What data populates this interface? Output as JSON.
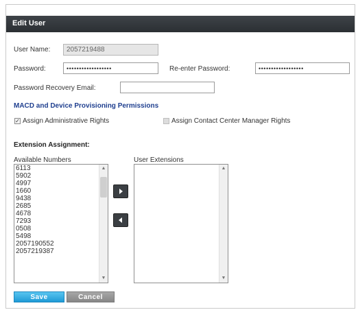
{
  "dialog": {
    "title": "Edit User"
  },
  "form": {
    "user_name_label": "User Name:",
    "user_name_value": "2057219488",
    "password_label": "Password:",
    "password_value": "••••••••••••••••••",
    "reenter_password_label": "Re-enter Password:",
    "reenter_password_value": "••••••••••••••••••",
    "recovery_email_label": "Password Recovery Email:",
    "recovery_email_value": ""
  },
  "permissions": {
    "section_title": "MACD and Device Provisioning Permissions",
    "admin_rights_label": "Assign Administrative Rights",
    "admin_rights_checked": true,
    "contact_center_label": "Assign Contact Center Manager Rights",
    "contact_center_checked": false
  },
  "extensions": {
    "heading": "Extension Assignment:",
    "available_label": "Available Numbers",
    "user_extensions_label": "User Extensions",
    "available_numbers": [
      "6113",
      "5902",
      "4997",
      "1660",
      "9438",
      "2685",
      "4678",
      "7293",
      "0508",
      "5498",
      "2057190552",
      "2057219387"
    ],
    "user_extensions": []
  },
  "icons": {
    "move_right": "arrow-right-icon",
    "move_left": "arrow-left-icon"
  },
  "buttons": {
    "save_label": "Save",
    "cancel_label": "Cancel"
  },
  "colors": {
    "titlebar": "#2f3337",
    "save": "#2aa7e0",
    "cancel": "#8f8f8f",
    "section_link": "#1f3f8f"
  }
}
